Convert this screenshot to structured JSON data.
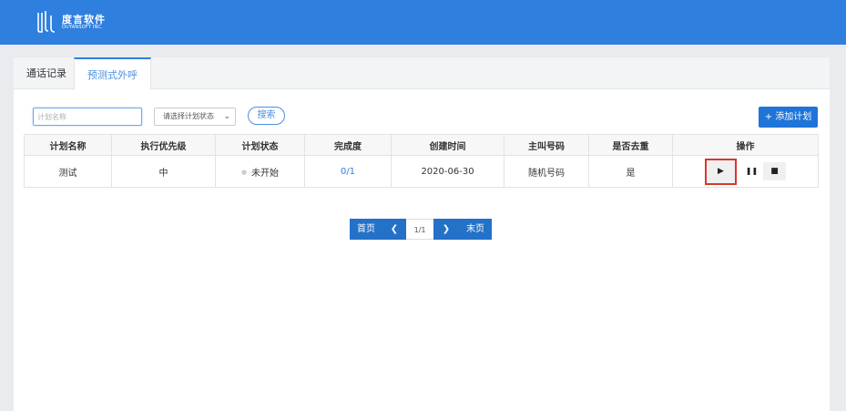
{
  "brand": {
    "name_cn": "度言软件",
    "name_en": "DUYANSOFT INC."
  },
  "tabs": [
    {
      "label": "通话记录",
      "active": false
    },
    {
      "label": "预测式外呼",
      "active": true
    }
  ],
  "filters": {
    "name_placeholder": "计划名称",
    "status_select": "请选择计划状态",
    "search_label": "搜索",
    "add_label": "+ 添加计划"
  },
  "table": {
    "headers": [
      "计划名称",
      "执行优先级",
      "计划状态",
      "完成度",
      "创建时间",
      "主叫号码",
      "是否去重",
      "操作"
    ],
    "rows": [
      {
        "name": "测试",
        "priority": "中",
        "status": "未开始",
        "progress": "0/1",
        "created": "2020-06-30",
        "caller": "随机号码",
        "dedup": "是",
        "actions": {
          "play": "▶",
          "pause": "❚❚",
          "stop": "■"
        }
      }
    ]
  },
  "pager": {
    "first": "首页",
    "prev_icon": "chevron-left-icon",
    "current": "1/1",
    "next_icon": "chevron-right-icon",
    "last": "末页"
  },
  "colors": {
    "header_blue": "#2f7fdf",
    "pager_blue": "#2471c8",
    "highlight_red": "#d9372e"
  }
}
